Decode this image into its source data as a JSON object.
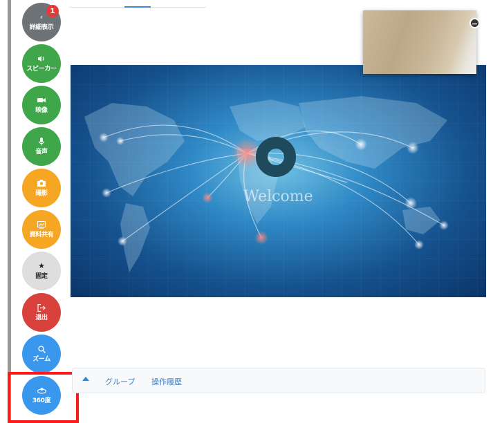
{
  "sidebar": {
    "items": [
      {
        "icon": "chevron-left",
        "label": "詳細表示",
        "color": "#6e7378",
        "badge": "1"
      },
      {
        "icon": "speaker",
        "label": "スピーカー",
        "color": "#3fa64a"
      },
      {
        "icon": "video-camera",
        "label": "映像",
        "color": "#3fa64a"
      },
      {
        "icon": "microphone",
        "label": "音声",
        "color": "#3fa64a"
      },
      {
        "icon": "camera",
        "label": "撮影",
        "color": "#f5a623"
      },
      {
        "icon": "document-share",
        "label": "資料共有",
        "color": "#f5a623"
      },
      {
        "icon": "star",
        "label": "固定",
        "color": "#dedede"
      },
      {
        "icon": "exit",
        "label": "退出",
        "color": "#d9413d"
      },
      {
        "icon": "zoom",
        "label": "ズーム",
        "color": "#3a97ee"
      },
      {
        "icon": "360-view",
        "label": "360度",
        "color": "#3a97ee"
      }
    ]
  },
  "stage": {
    "welcome_text": "Welcome"
  },
  "bottom_tabs": {
    "group": "グループ",
    "history": "操作履歴"
  }
}
